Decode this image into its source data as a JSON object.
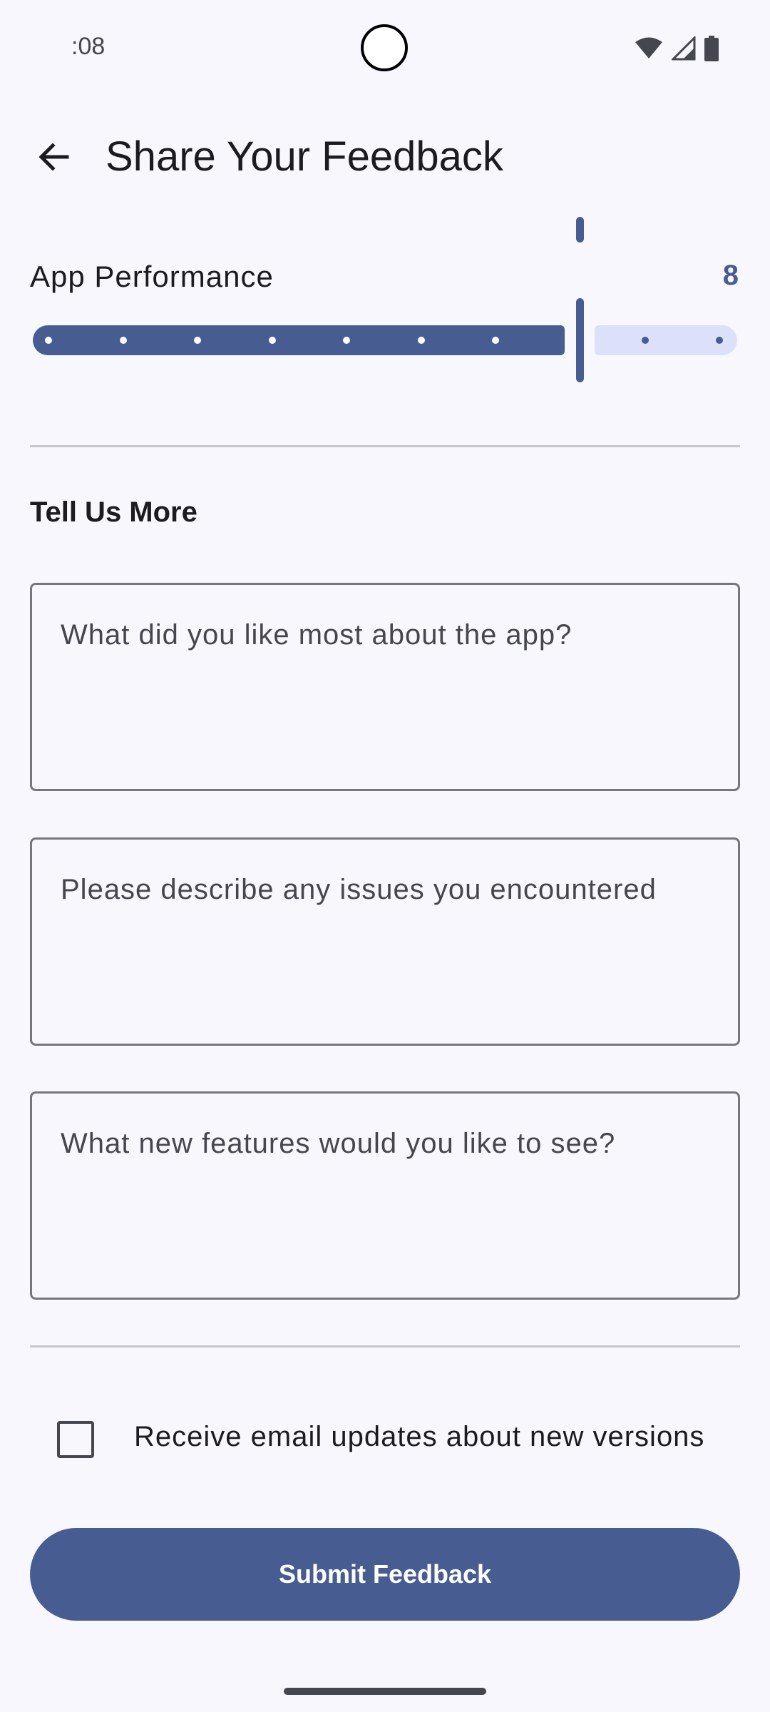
{
  "status_bar": {
    "time": ":08"
  },
  "header": {
    "title": "Share Your Feedback"
  },
  "rating": {
    "label": "App Performance",
    "value": "8",
    "min": 1,
    "max": 10,
    "current": 8
  },
  "tell_us_more": {
    "title": "Tell Us More",
    "liked_placeholder": "What did you like most about the app?",
    "issues_placeholder": "Please describe any issues you encountered",
    "features_placeholder": "What new features would you like to see?"
  },
  "email_updates": {
    "label": "Receive email updates about new versions",
    "checked": false
  },
  "submit": {
    "label": "Submit Feedback"
  },
  "colors": {
    "primary": "#475d92",
    "track_inactive": "#dce1f9",
    "background": "#f8f7fd"
  }
}
